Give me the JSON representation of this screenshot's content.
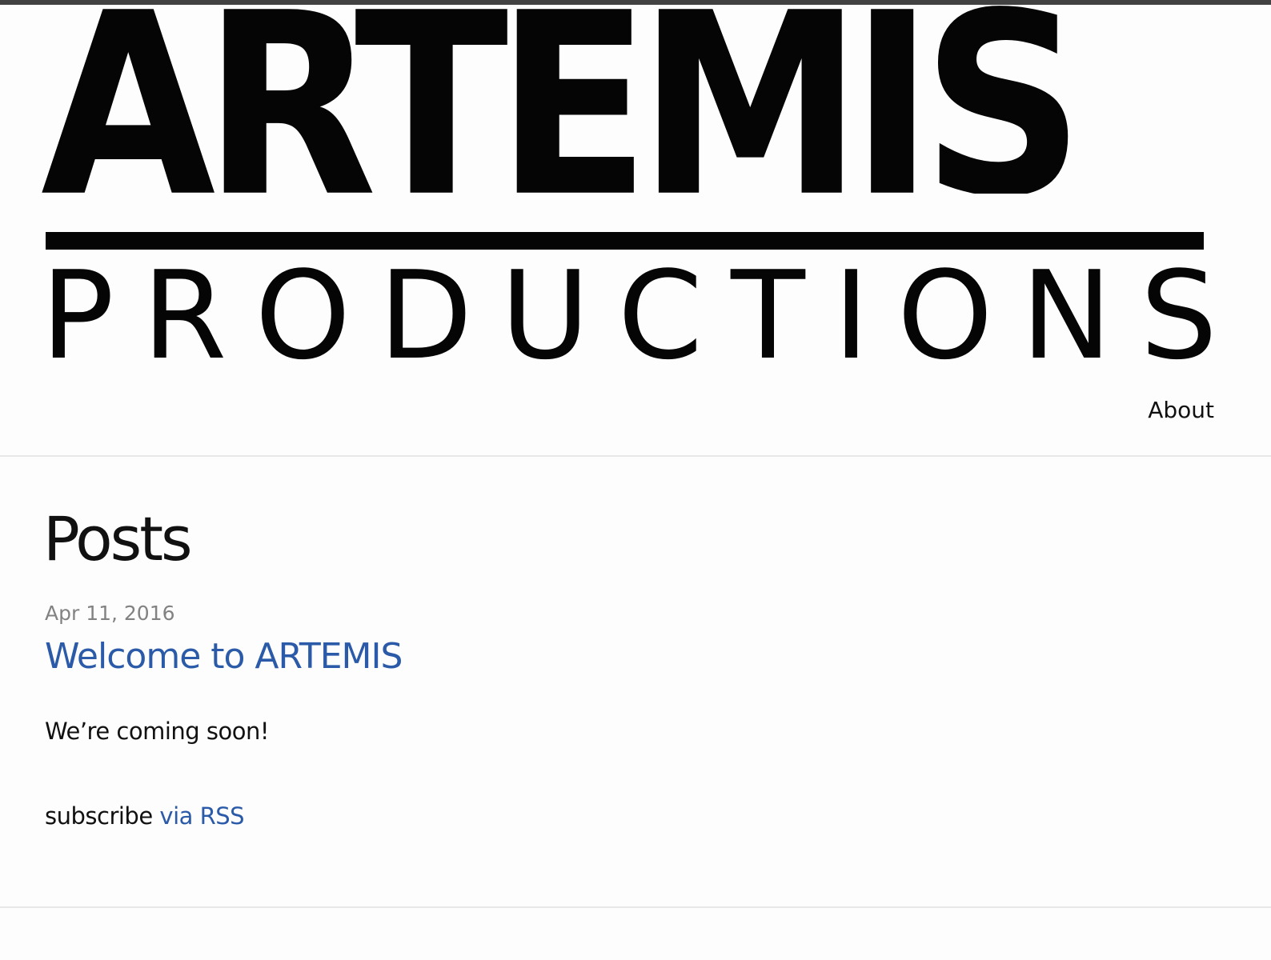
{
  "header": {
    "logo": {
      "line1": "ARTEMIS",
      "line2_letters": [
        "P",
        "R",
        "O",
        "D",
        "U",
        "C",
        "T",
        "I",
        "O",
        "N",
        "S"
      ]
    },
    "nav": {
      "about_label": "About"
    }
  },
  "main": {
    "heading": "Posts",
    "posts": [
      {
        "date": "Apr 11, 2016",
        "title": "Welcome to ARTEMIS",
        "excerpt": "We’re coming soon!"
      }
    ],
    "subscribe": {
      "prefix": "subscribe ",
      "link_label": "via RSS"
    }
  },
  "colors": {
    "link": "#2a5aa8",
    "meta": "#828282",
    "text": "#111111",
    "background": "#fdfdfd",
    "top_bar": "#424242"
  }
}
